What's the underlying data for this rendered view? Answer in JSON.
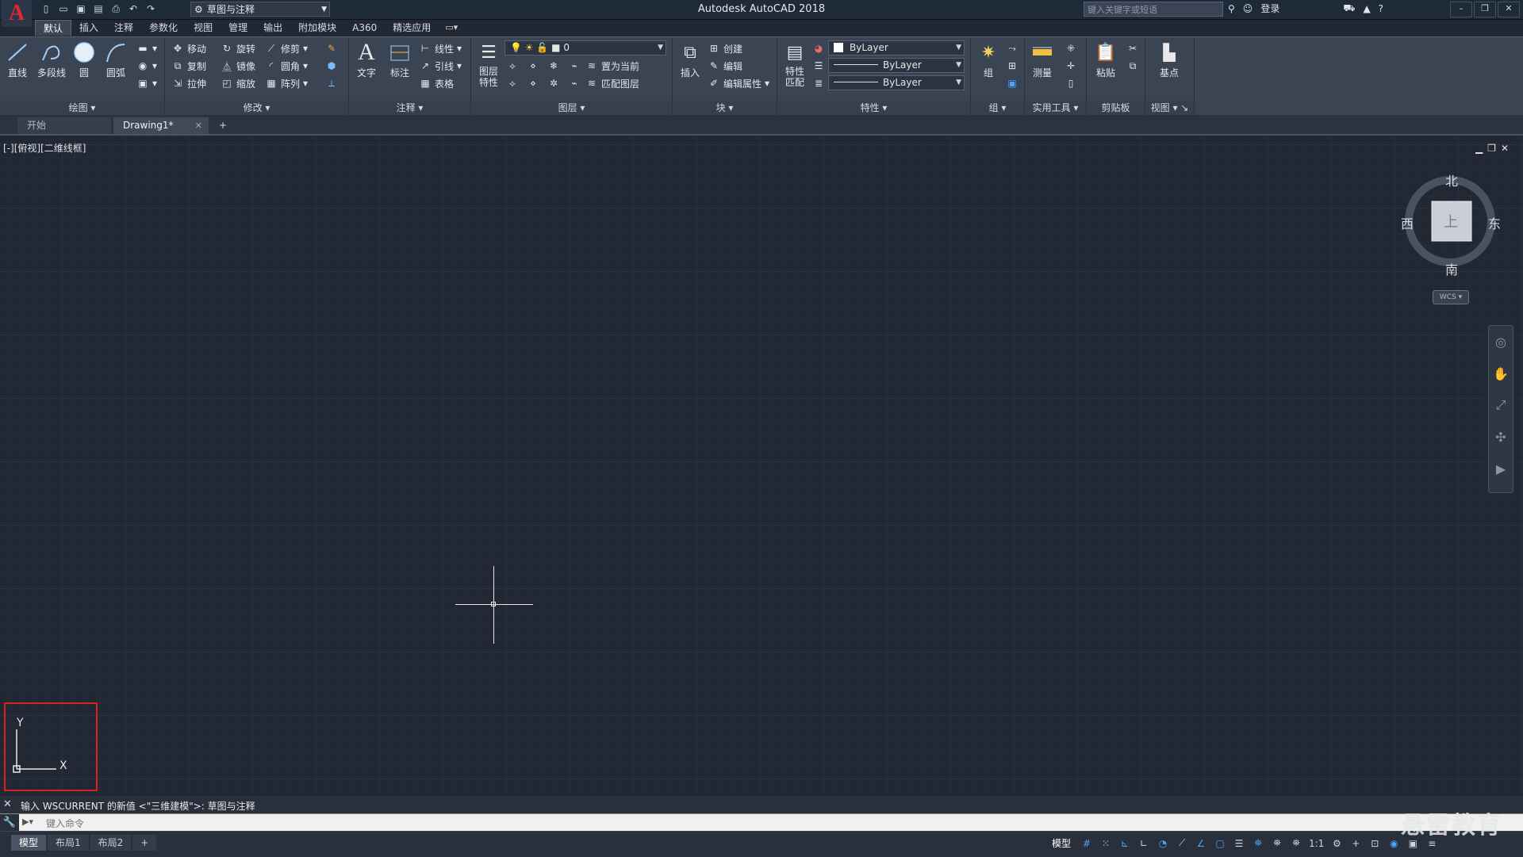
{
  "window": {
    "title": "Autodesk AutoCAD 2018",
    "workspace": "草图与注释",
    "search_placeholder": "键入关键字或短语",
    "login": "登录"
  },
  "app_logo": "A",
  "ribbon_tabs": [
    "默认",
    "插入",
    "注释",
    "参数化",
    "视图",
    "管理",
    "输出",
    "附加模块",
    "A360",
    "精选应用"
  ],
  "ribbon": {
    "draw": {
      "title": "绘图",
      "line": "直线",
      "polyline": "多段线",
      "circle": "圆",
      "arc": "圆弧"
    },
    "modify": {
      "title": "修改",
      "move": "移动",
      "rotate": "旋转",
      "trim": "修剪",
      "copy": "复制",
      "mirror": "镜像",
      "fillet": "圆角",
      "stretch": "拉伸",
      "scale": "缩放",
      "array": "阵列"
    },
    "annotation": {
      "title": "注释",
      "text": "文字",
      "dimension": "标注",
      "linear": "线性",
      "leader": "引线",
      "table": "表格"
    },
    "layers": {
      "title": "图层",
      "layer_props": "图层\n特性",
      "current_layer": "0",
      "make_current": "置为当前",
      "match_layer": "匹配图层"
    },
    "block": {
      "title": "块",
      "insert": "插入",
      "create": "创建",
      "edit": "编辑",
      "edit_attr": "编辑属性"
    },
    "properties": {
      "title": "特性",
      "match_props": "特性\n匹配",
      "color": "ByLayer",
      "linetype": "ByLayer",
      "lineweight": "ByLayer"
    },
    "groups": {
      "title": "组",
      "group": "组"
    },
    "utilities": {
      "title": "实用工具",
      "measure": "测量"
    },
    "clipboard": {
      "title": "剪贴板",
      "paste": "粘贴"
    },
    "view": {
      "title": "视图",
      "base": "基点"
    }
  },
  "doc_tabs": {
    "start": "开始",
    "drawing": "Drawing1*"
  },
  "viewport_label": "[-][俯视][二维线框]",
  "viewcube": {
    "north": "北",
    "south": "南",
    "east": "东",
    "west": "西",
    "top": "上",
    "wcs": "WCS"
  },
  "ucs": {
    "x": "X",
    "y": "Y"
  },
  "command": {
    "history": "输入 WSCURRENT 的新值 <\"三维建模\">: 草图与注释",
    "placeholder": "键入命令"
  },
  "layout_tabs": [
    "模型",
    "布局1",
    "布局2"
  ],
  "status": {
    "model": "模型",
    "scale": "1:1"
  },
  "watermark": "悬雷教育"
}
